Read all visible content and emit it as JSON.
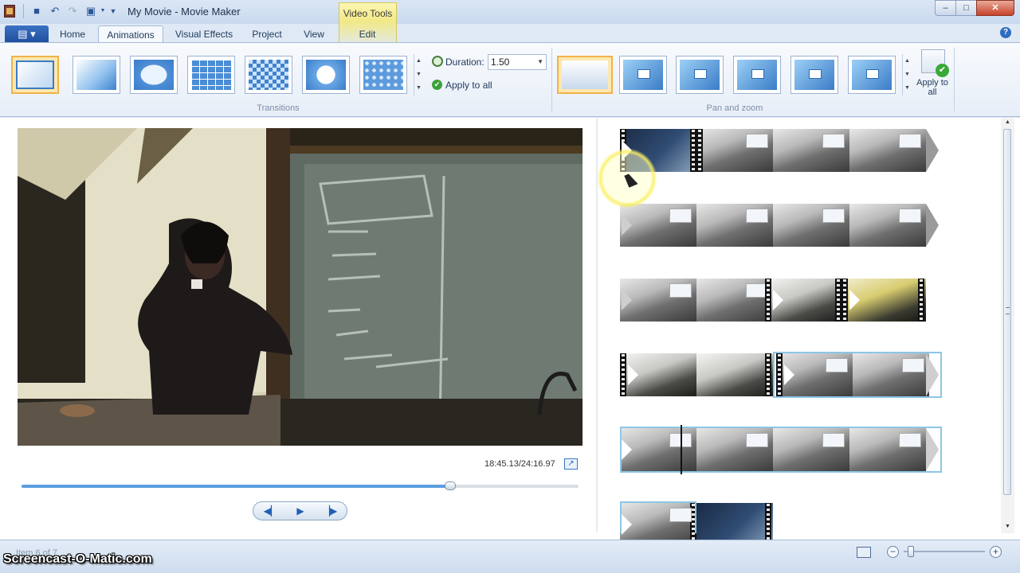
{
  "window": {
    "title": "My Movie - Movie Maker",
    "contextual_tab_group": "Video Tools",
    "controls": {
      "minimize": "–",
      "maximize": "□",
      "close": "✕"
    }
  },
  "quick_access": [
    "save-icon",
    "undo-icon",
    "redo-icon",
    "snapshot-icon",
    "customize-dropdown-icon"
  ],
  "tabs": [
    {
      "label": "Home",
      "active": false
    },
    {
      "label": "Animations",
      "active": true
    },
    {
      "label": "Visual Effects",
      "active": false
    },
    {
      "label": "Project",
      "active": false
    },
    {
      "label": "View",
      "active": false
    },
    {
      "label": "Edit",
      "active": false
    }
  ],
  "ribbon": {
    "transitions": {
      "group_label": "Transitions",
      "items": [
        "none",
        "fade",
        "blob",
        "bricks",
        "checkerboard",
        "circle",
        "dots"
      ],
      "selected_index": 0
    },
    "duration": {
      "label": "Duration:",
      "value": "1.50"
    },
    "apply_to_all": {
      "label": "Apply to all"
    },
    "pan_zoom": {
      "group_label": "Pan and zoom",
      "items": [
        "none",
        "automatic",
        "pan-up-left",
        "pan-up",
        "pan-up-right",
        "pan-down"
      ],
      "selected_index": 0
    },
    "apply_to_all_big": {
      "label": "Apply to all"
    }
  },
  "preview": {
    "timecode": "18:45.13/24:16.97",
    "seek_progress": 0.77,
    "controls": {
      "previous_frame": "◀▏",
      "play": "▶",
      "next_frame": "▕▶"
    }
  },
  "storyboard": {
    "rows": 6,
    "selected_item": 6
  },
  "status": {
    "text": "Item 6 of 7",
    "zoom_level": 0.05
  },
  "watermark": "Screencast-O-Matic.com",
  "colors": {
    "ribbon_bg": "#e7eef8",
    "selection": "#f1b24a",
    "storyboard_selection": "#8cc6e6",
    "accent": "#3a7cc7"
  }
}
